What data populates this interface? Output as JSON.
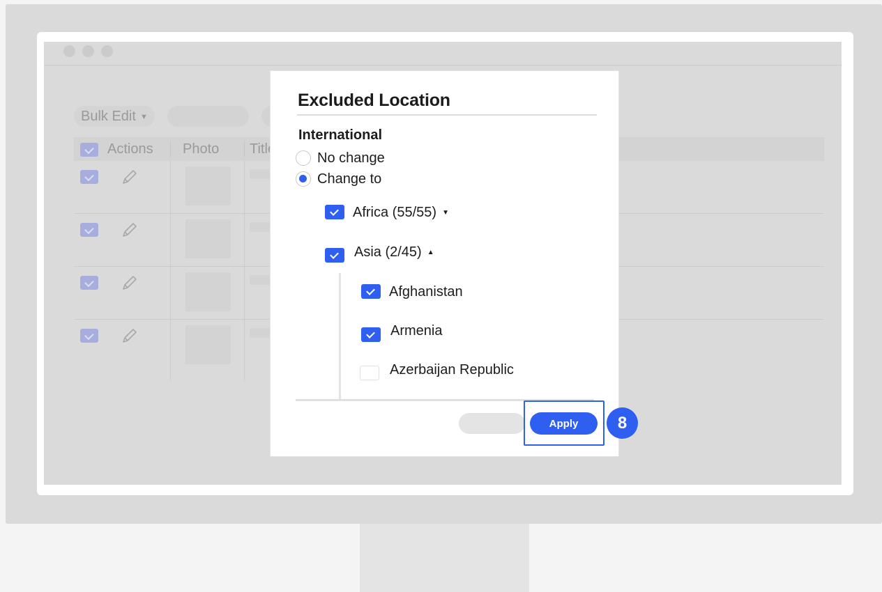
{
  "background_table": {
    "bulk_edit_label": "Bulk Edit",
    "columns": [
      "Actions",
      "Photo",
      "Title"
    ],
    "row_count": 4
  },
  "modal": {
    "title": "Excluded Location",
    "section_label": "International",
    "options": [
      {
        "label": "No change",
        "selected": false
      },
      {
        "label": "Change to",
        "selected": true
      }
    ],
    "regions": [
      {
        "label": "Africa (55/55)",
        "checked": true,
        "expanded": false
      },
      {
        "label": "Asia (2/45)",
        "checked": true,
        "expanded": true,
        "countries": [
          {
            "label": "Afghanistan",
            "checked": true
          },
          {
            "label": "Armenia",
            "checked": true
          },
          {
            "label": "Azerbaijan Republic",
            "checked": false
          }
        ]
      }
    ],
    "apply_label": "Apply"
  },
  "annotation": {
    "step_number": "8",
    "color": "#2f5ff0"
  },
  "colors": {
    "accent": "#2f5ff0",
    "overlay_gray": "#dadada"
  }
}
